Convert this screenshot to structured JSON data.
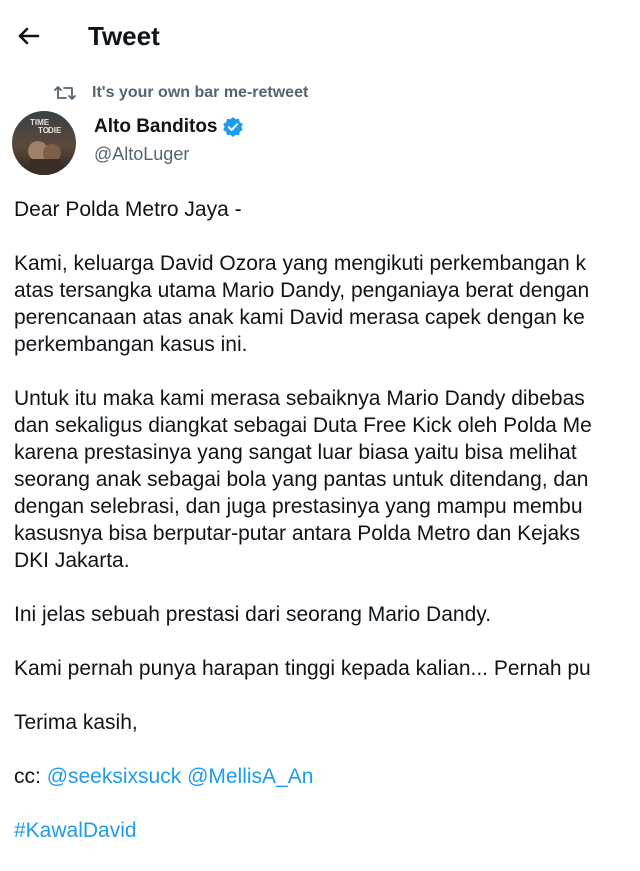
{
  "header": {
    "title": "Tweet",
    "back_icon": "arrow-left-icon"
  },
  "retweet": {
    "icon": "retweet-icon",
    "text": "It's your own bar me-retweet"
  },
  "author": {
    "name": "Alto Banditos",
    "handle": "@AltoLuger",
    "verified_icon": "verified-badge-icon",
    "verified_color": "#1d9bf0",
    "avatar_text": "TIME TO DIE"
  },
  "tweet": {
    "greeting": "Dear Polda Metro Jaya -",
    "para1": [
      "Kami, keluarga David Ozora yang mengikuti perkembangan k",
      "atas tersangka utama Mario Dandy, penganiaya berat dengan",
      "perencanaan atas anak kami David merasa capek dengan ke",
      "perkembangan kasus ini."
    ],
    "para2": [
      "Untuk itu maka kami merasa sebaiknya Mario Dandy dibebas",
      "dan sekaligus diangkat sebagai Duta Free Kick oleh Polda Me",
      "karena prestasinya yang sangat luar biasa yaitu bisa melihat",
      "seorang anak sebagai bola yang pantas untuk ditendang, dan",
      "dengan selebrasi, dan juga prestasinya yang mampu membu",
      "kasusnya bisa berputar-putar antara Polda Metro dan Kejaks",
      "DKI Jakarta."
    ],
    "para3": "Ini jelas sebuah prestasi dari seorang Mario Dandy.",
    "para4": "Kami pernah punya harapan tinggi kepada kalian... Pernah pu",
    "closing": "Terima kasih,",
    "cc_label": "cc:",
    "mentions": [
      "@seeksixsuck",
      "@MellisA_An"
    ],
    "hashtag": "#KawalDavid",
    "link_color": "#1d9bf0"
  }
}
